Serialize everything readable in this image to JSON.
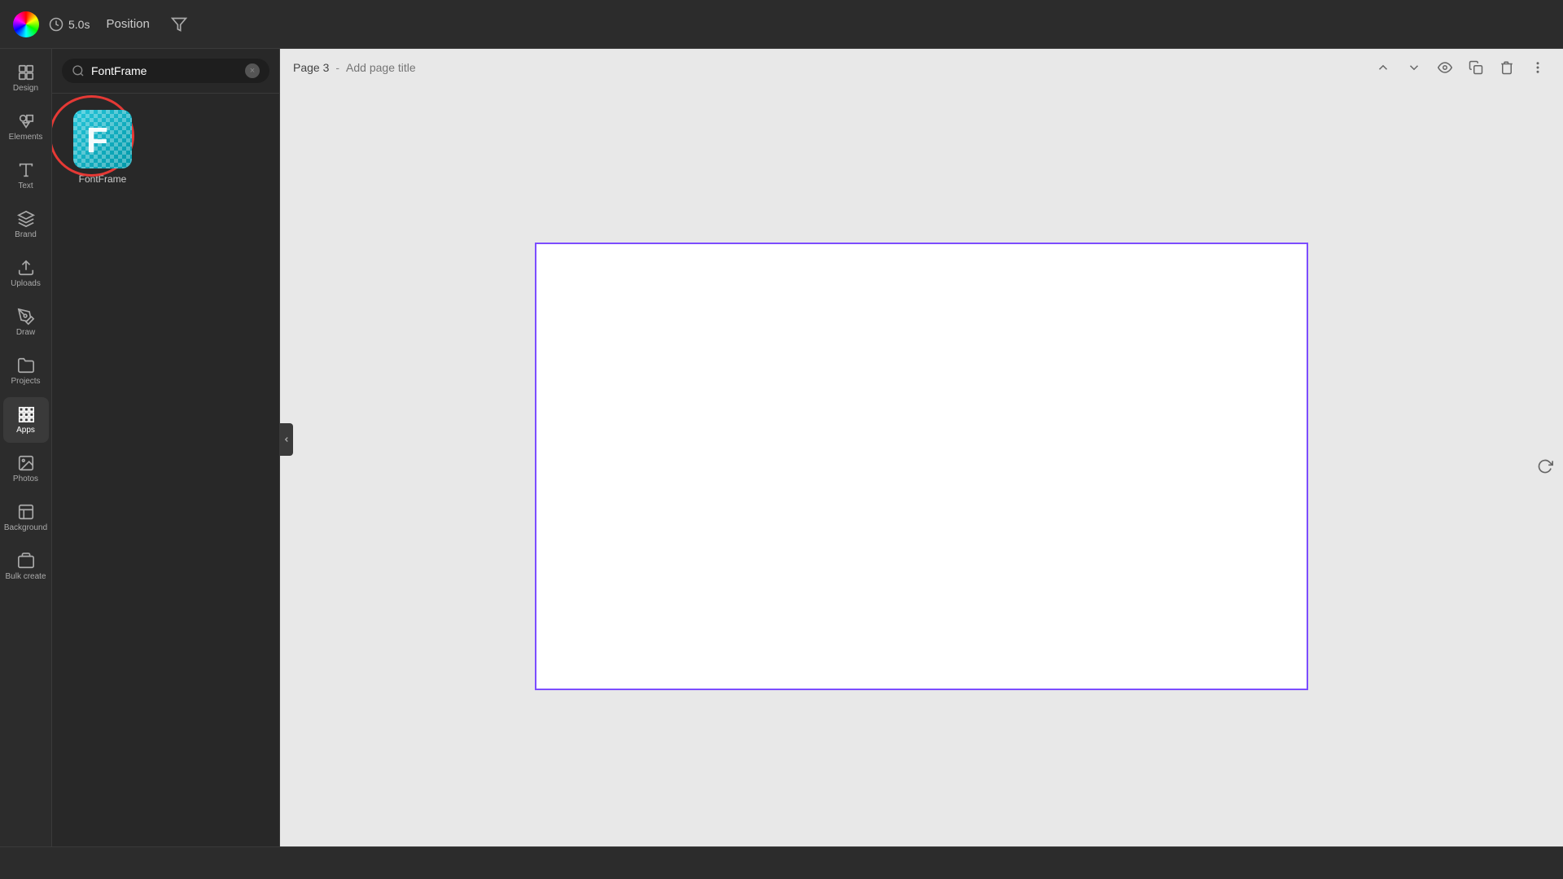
{
  "toolbar": {
    "time_label": "5.0s",
    "position_label": "Position",
    "color_icon": "color-wheel-icon",
    "clock_icon": "clock-icon",
    "filter_icon": "filter-icon"
  },
  "sidebar": {
    "items": [
      {
        "id": "design",
        "label": "Design",
        "icon": "design-icon"
      },
      {
        "id": "elements",
        "label": "Elements",
        "icon": "elements-icon"
      },
      {
        "id": "text",
        "label": "Text",
        "icon": "text-icon"
      },
      {
        "id": "brand",
        "label": "Brand",
        "icon": "brand-icon"
      },
      {
        "id": "uploads",
        "label": "Uploads",
        "icon": "uploads-icon"
      },
      {
        "id": "draw",
        "label": "Draw",
        "icon": "draw-icon"
      },
      {
        "id": "projects",
        "label": "Projects",
        "icon": "projects-icon"
      },
      {
        "id": "apps",
        "label": "Apps",
        "icon": "apps-icon",
        "active": true
      },
      {
        "id": "photos",
        "label": "Photos",
        "icon": "photos-icon"
      },
      {
        "id": "background",
        "label": "Background",
        "icon": "background-icon"
      },
      {
        "id": "bulk-create",
        "label": "Bulk create",
        "icon": "bulk-create-icon"
      }
    ]
  },
  "panel": {
    "search_placeholder": "FontFrame",
    "search_value": "FontFrame",
    "clear_btn": "×",
    "app_item": {
      "name": "FontFrame",
      "icon_letter": "F"
    }
  },
  "canvas": {
    "page_label": "Page 3",
    "page_title_placeholder": "Add page title",
    "page_title_separator": "-"
  },
  "header_actions": [
    {
      "id": "collapse-up",
      "icon": "chevron-up-icon"
    },
    {
      "id": "chevron-down",
      "icon": "chevron-down-icon"
    },
    {
      "id": "visibility",
      "icon": "eye-icon"
    },
    {
      "id": "copy",
      "icon": "copy-icon"
    },
    {
      "id": "delete",
      "icon": "trash-icon"
    },
    {
      "id": "more",
      "icon": "more-icon"
    }
  ]
}
